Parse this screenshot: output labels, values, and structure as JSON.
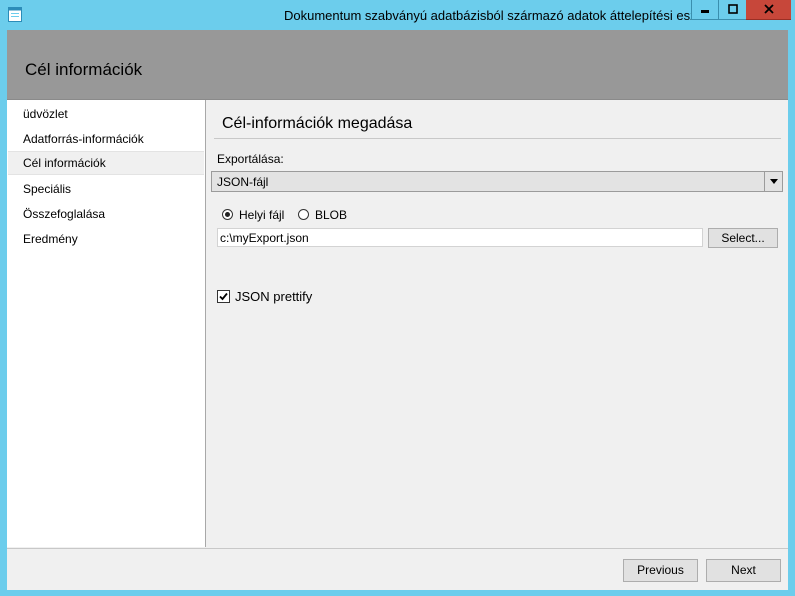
{
  "window": {
    "title": "Dokumentum szabványú adatbázisból származó adatok áttelepítési eszköz",
    "app_icon": "app-icon",
    "controls": {
      "minimize_icon": "minimize-icon",
      "maximize_icon": "maximize-icon",
      "close_icon": "close-icon"
    }
  },
  "header": {
    "title": "Cél információk"
  },
  "sidebar": {
    "items": [
      {
        "label": "üdvözlet"
      },
      {
        "label": "Adatforrás-információk"
      },
      {
        "label": "Cél információk",
        "selected": true
      },
      {
        "label": "Speciális"
      },
      {
        "label": "Összefoglalása"
      },
      {
        "label": "Eredmény"
      }
    ]
  },
  "main": {
    "section_title": "Cél-információk megadása",
    "export_label": "Exportálása:",
    "export_select": {
      "value": "JSON-fájl"
    },
    "radios": [
      {
        "label": "Helyi fájl",
        "checked": true
      },
      {
        "label": "BLOB",
        "checked": false
      }
    ],
    "path_input": {
      "value": "c:\\myExport.json"
    },
    "select_button": "Select...",
    "prettify": {
      "label": "JSON prettify",
      "checked": true
    }
  },
  "footer": {
    "previous": "Previous",
    "next": "Next"
  },
  "colors": {
    "titlebar": "#6ccdec",
    "close": "#c7473a",
    "header_band": "#989898",
    "panel": "#f0f0f0"
  }
}
